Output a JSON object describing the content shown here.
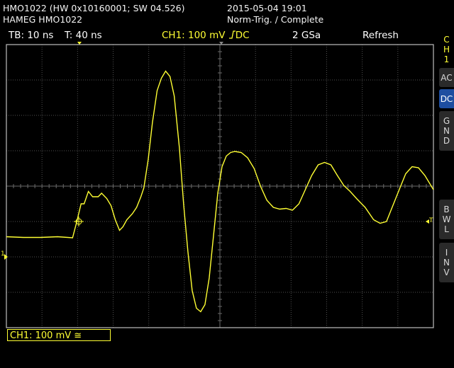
{
  "header": {
    "device_line1": "HMO1022 (HW 0x10160001; SW 04.526)",
    "device_line2": "HAMEG HMO1022",
    "timestamp": "2015-05-04 19:01",
    "trigger_status": "Norm-Trig. / Complete"
  },
  "status_bar": {
    "timebase": "TB: 10 ns",
    "trigger_time": "T: 40 ns",
    "channel": "CH1: 100 mV",
    "coupling": "DC",
    "sample_rate": "2 GSa",
    "mode": "Refresh"
  },
  "softkeys": {
    "ch1_label": [
      "C",
      "H",
      "1"
    ],
    "ac": "AC",
    "dc": "DC",
    "gnd": [
      "G",
      "N",
      "D"
    ],
    "bwl": [
      "B",
      "W",
      "L"
    ],
    "inv": [
      "I",
      "N",
      "V"
    ]
  },
  "markers": {
    "channel_marker": "1",
    "trigger_level_marker": "T"
  },
  "channel_box": {
    "label": "CH1: 100 mV ≅"
  },
  "colors": {
    "trace": "#ffff33",
    "grid": "#505050",
    "border": "#bdbdbd",
    "active_softkey": "#1e4ea0"
  },
  "waveform": {
    "x_range": [
      0,
      100
    ],
    "y_range": [
      -4,
      4
    ],
    "description_units": "x in % of screen width, y in divisions (100 mV/div)",
    "points": [
      [
        0,
        -1.43
      ],
      [
        4,
        -1.45
      ],
      [
        8,
        -1.45
      ],
      [
        12,
        -1.43
      ],
      [
        15.5,
        -1.46
      ],
      [
        16.5,
        -1.0
      ],
      [
        17.5,
        -0.5
      ],
      [
        18.2,
        -0.5
      ],
      [
        19.2,
        -0.15
      ],
      [
        20.2,
        -0.3
      ],
      [
        21.5,
        -0.3
      ],
      [
        22.3,
        -0.2
      ],
      [
        23.5,
        -0.35
      ],
      [
        24.5,
        -0.55
      ],
      [
        25.5,
        -0.95
      ],
      [
        26.5,
        -1.25
      ],
      [
        27.3,
        -1.15
      ],
      [
        28.2,
        -0.95
      ],
      [
        29.5,
        -0.78
      ],
      [
        30.5,
        -0.6
      ],
      [
        31.5,
        -0.3
      ],
      [
        32.2,
        -0.05
      ],
      [
        33.2,
        0.75
      ],
      [
        34.2,
        1.8
      ],
      [
        35.3,
        2.7
      ],
      [
        36.3,
        3.05
      ],
      [
        37.3,
        3.25
      ],
      [
        38.3,
        3.1
      ],
      [
        39.3,
        2.55
      ],
      [
        40.5,
        1.1
      ],
      [
        41.5,
        -0.5
      ],
      [
        42.5,
        -1.85
      ],
      [
        43.5,
        -2.95
      ],
      [
        44.5,
        -3.45
      ],
      [
        45.5,
        -3.55
      ],
      [
        46.5,
        -3.35
      ],
      [
        47.5,
        -2.6
      ],
      [
        48.5,
        -1.4
      ],
      [
        49.5,
        -0.2
      ],
      [
        50.5,
        0.55
      ],
      [
        51.5,
        0.85
      ],
      [
        52.5,
        0.95
      ],
      [
        53.5,
        0.98
      ],
      [
        55.0,
        0.95
      ],
      [
        56.5,
        0.8
      ],
      [
        58.0,
        0.5
      ],
      [
        59.5,
        0.0
      ],
      [
        61.0,
        -0.4
      ],
      [
        62.5,
        -0.6
      ],
      [
        64.0,
        -0.65
      ],
      [
        65.5,
        -0.63
      ],
      [
        67.0,
        -0.68
      ],
      [
        68.5,
        -0.5
      ],
      [
        70.0,
        -0.1
      ],
      [
        71.5,
        0.3
      ],
      [
        73.0,
        0.6
      ],
      [
        74.5,
        0.67
      ],
      [
        76.0,
        0.6
      ],
      [
        77.5,
        0.3
      ],
      [
        79.0,
        0.02
      ],
      [
        80.5,
        -0.15
      ],
      [
        82.0,
        -0.35
      ],
      [
        84.0,
        -0.6
      ],
      [
        86.0,
        -0.95
      ],
      [
        87.5,
        -1.05
      ],
      [
        89.0,
        -1.0
      ],
      [
        90.5,
        -0.55
      ],
      [
        92.0,
        -0.1
      ],
      [
        93.5,
        0.35
      ],
      [
        95.0,
        0.55
      ],
      [
        96.5,
        0.52
      ],
      [
        98.0,
        0.3
      ],
      [
        100,
        -0.1
      ]
    ]
  }
}
